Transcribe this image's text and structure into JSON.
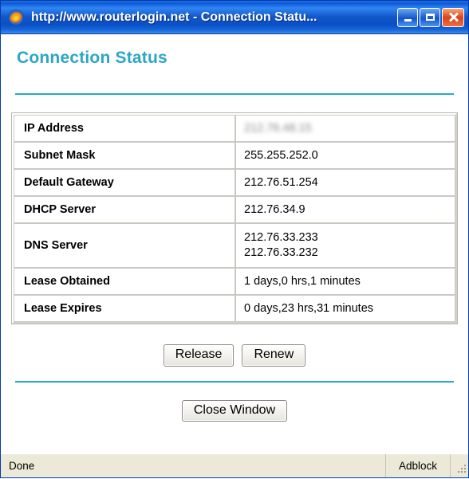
{
  "window": {
    "title": "http://www.routerlogin.net - Connection Statu...",
    "icon": "firefox-icon",
    "buttons": {
      "minimize": "Minimize",
      "maximize": "Maximize",
      "close": "Close"
    }
  },
  "page": {
    "heading": "Connection Status",
    "heading_color": "#2ba6c4",
    "rule_color": "#29a8c8"
  },
  "table": {
    "rows": [
      {
        "label": "IP Address",
        "value": "212.76.48.15",
        "redacted": true
      },
      {
        "label": "Subnet Mask",
        "value": "255.255.252.0"
      },
      {
        "label": "Default Gateway",
        "value": "212.76.51.254"
      },
      {
        "label": "DHCP Server",
        "value": "212.76.34.9"
      },
      {
        "label": "DNS Server",
        "value_line1": "212.76.33.233",
        "value_line2": "212.76.33.232"
      },
      {
        "label": "Lease Obtained",
        "value": "1 days,0 hrs,1 minutes"
      },
      {
        "label": "Lease Expires",
        "value": "0 days,23 hrs,31 minutes"
      }
    ]
  },
  "actions": {
    "release": "Release",
    "renew": "Renew",
    "close_window": "Close Window"
  },
  "statusbar": {
    "status": "Done",
    "adblock": "Adblock",
    "grip": "resize-grip-icon"
  }
}
